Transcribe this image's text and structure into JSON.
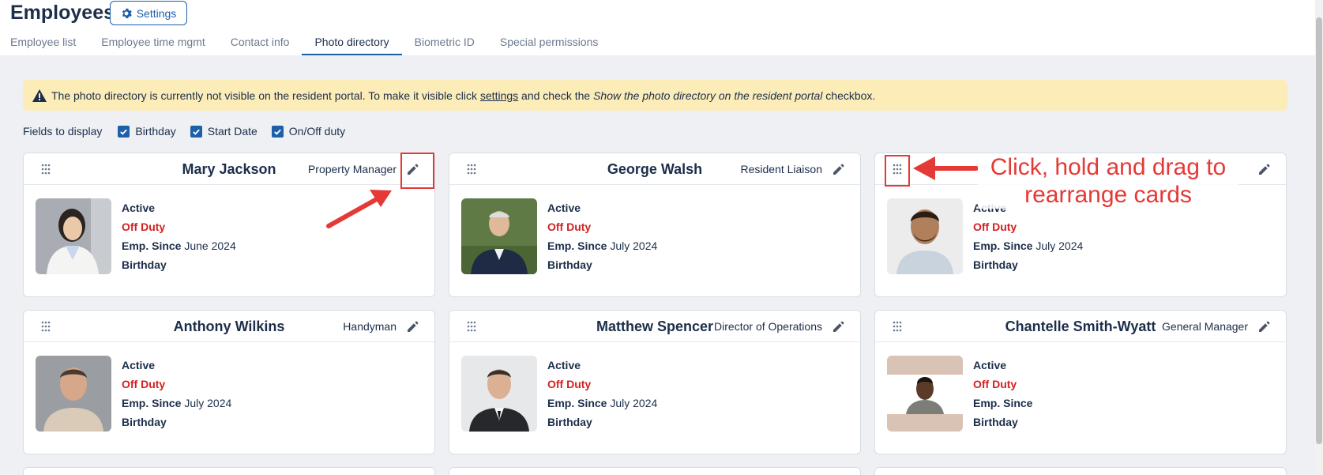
{
  "header": {
    "title": "Employees",
    "settings_label": "Settings"
  },
  "tabs": [
    {
      "label": "Employee list"
    },
    {
      "label": "Employee time mgmt"
    },
    {
      "label": "Contact info"
    },
    {
      "label": "Photo directory",
      "active": true
    },
    {
      "label": "Biometric ID"
    },
    {
      "label": "Special permissions"
    }
  ],
  "banner": {
    "text_before": "The photo directory is currently not visible on the resident portal. To make it visible click ",
    "link": "settings",
    "text_middle": " and check the ",
    "emphasis": "Show the photo directory on the resident portal",
    "text_after": " checkbox."
  },
  "fields": {
    "label": "Fields to display",
    "options": [
      {
        "label": "Birthday",
        "checked": true
      },
      {
        "label": "Start Date",
        "checked": true
      },
      {
        "label": "On/Off duty",
        "checked": true
      }
    ]
  },
  "labels": {
    "emp_since": "Emp. Since",
    "birthday": "Birthday"
  },
  "employees": [
    {
      "name": "Mary Jackson",
      "role": "Property Manager",
      "status": "Active",
      "duty": "Off Duty",
      "since": "June 2024"
    },
    {
      "name": "George Walsh",
      "role": "Resident Liaison",
      "status": "Active",
      "duty": "Off Duty",
      "since": "July 2024"
    },
    {
      "name": "",
      "role": "",
      "status": "Active",
      "duty": "Off Duty",
      "since": "July 2024"
    },
    {
      "name": "Anthony Wilkins",
      "role": "Handyman",
      "status": "Active",
      "duty": "Off Duty",
      "since": "July 2024"
    },
    {
      "name": "Matthew Spencer",
      "role": "Director of Operations",
      "status": "Active",
      "duty": "Off Duty",
      "since": "July 2024"
    },
    {
      "name": "Chantelle Smith-Wyatt",
      "role": "General Manager",
      "status": "Active",
      "duty": "Off Duty",
      "since": ""
    }
  ],
  "annotation": {
    "text_line1": "Click, hold and drag to",
    "text_line2": "rearrange cards"
  },
  "colors": {
    "accent": "#1d5fa8",
    "off_duty": "#d32020",
    "banner_bg": "#fcecb8",
    "annotation": "#e53935"
  }
}
